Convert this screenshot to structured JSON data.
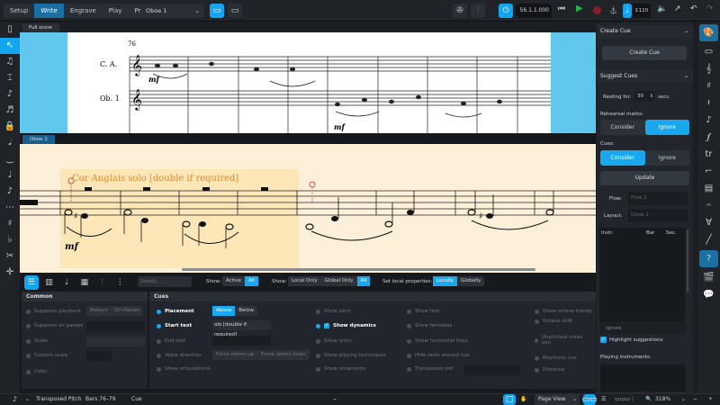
{
  "topbar": {
    "modes": [
      "Setup",
      "Write",
      "Engrave",
      "Play",
      "Print"
    ],
    "active_mode": "Write",
    "layout_select": "Oboe 1",
    "timecode": "56.1.1.000",
    "tempo": "120"
  },
  "score": {
    "full_tab": "Full score",
    "part_tab": "Oboe 1",
    "bar_number": "76",
    "staff_labels": [
      "C. A.",
      "Ob. 1"
    ],
    "dynamic": "mf",
    "cue_text": "Cor Anglais solo [double if required]"
  },
  "lower": {
    "search_placeholder": "Search...",
    "show1_label": "Show:",
    "show1": [
      "Active",
      "All"
    ],
    "show2_label": "Show:",
    "show2": [
      "Local Only",
      "Global Only",
      "All"
    ],
    "setlocal_label": "Set local properties:",
    "setlocal": [
      "Locally",
      "Globally"
    ],
    "common": {
      "title": "Common",
      "props": [
        "Suppress playback",
        "Suppress on passes",
        "Scale",
        "Custom scale",
        "Color"
      ],
      "passes": [
        "Always",
        "On Passes"
      ]
    },
    "cues": {
      "title": "Cues",
      "col1": [
        "Placement",
        "Start text",
        "End text",
        "Voice direction",
        "Show articulations"
      ],
      "placement": [
        "Above",
        "Below"
      ],
      "start_text_value": "olo [double if required]",
      "voice": [
        "Force stems up",
        "Force stems down"
      ],
      "col2": [
        "Show slurs",
        "Show dynamics",
        "Show lyrics",
        "Show playing techniques",
        "Show ornaments"
      ],
      "col3": [
        "Show text",
        "Show fermatas",
        "Show horizontal lines",
        "Hide rests around cue",
        "Transposed clef"
      ],
      "col4": [
        "Show octave transp",
        "Octave shift",
        "Unpitched notes pos.",
        "Rhythmic cue",
        "Distance"
      ]
    }
  },
  "right": {
    "create_header": "Create Cue",
    "create_button": "Create Cue",
    "suggest_header": "Suggest Cues",
    "resting_label": "Resting for:",
    "resting_value": "30",
    "resting_unit": "secs.",
    "rehearsal_label": "Rehearsal marks:",
    "rehearsal": [
      "Consider",
      "Ignore"
    ],
    "cues_label": "Cues:",
    "cues": [
      "Consider",
      "Ignore"
    ],
    "update": "Update",
    "flow_label": "Flow:",
    "flow_value": "Flow 1",
    "layout_label": "Layout:",
    "layout_value": "Oboe 1",
    "table_headers": [
      "Instr.",
      "Bar",
      "Sec."
    ],
    "ignore": "Ignore",
    "highlight": "Highlight suggestions",
    "playing": "Playing instruments:"
  },
  "status": {
    "pitch": "Transposed Pitch",
    "bars": "Bars 76–79",
    "selection": "Cue",
    "view": "Page View",
    "zoom": "318%"
  },
  "colors": {
    "accent": "#18a8f0",
    "cue_text": "#e08a2c",
    "page_cream": "#fdf0d8",
    "blue_margin": "#62c7ec"
  }
}
